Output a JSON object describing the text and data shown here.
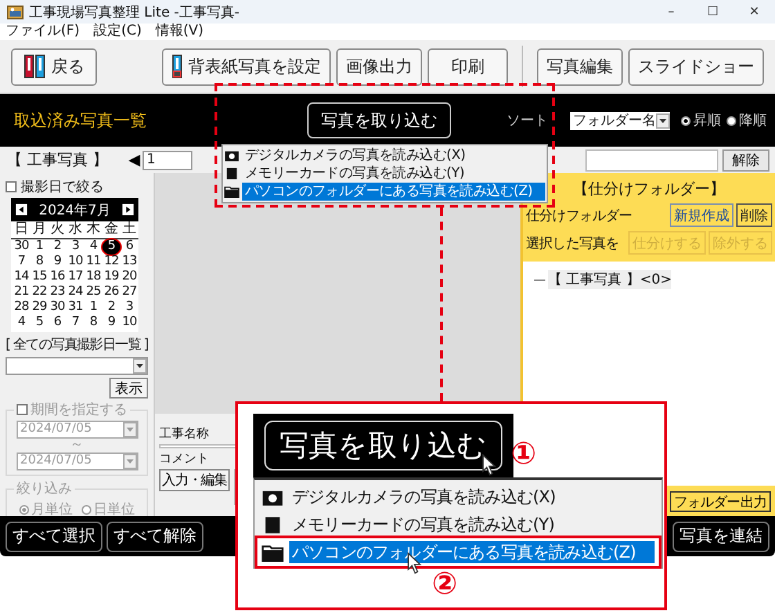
{
  "window": {
    "title": "工事現場写真整理 Lite -工事写真-",
    "controls": [
      "–",
      "☐",
      "✕"
    ]
  },
  "menu": [
    "ファイル(F)",
    "設定(C)",
    "情報(V)"
  ],
  "toolbar": {
    "back": "戻る",
    "spine": "背表紙写真を設定",
    "buttons": [
      "画像出力",
      "印刷"
    ],
    "right_buttons": [
      "写真編集",
      "スライドショー"
    ]
  },
  "header": {
    "title": "取込済み写真一覧",
    "import_button": "写真を取り込む",
    "sort_label": "ソート",
    "sort_value": "フォルダー名",
    "order": [
      {
        "label": "昇順",
        "selected": true
      },
      {
        "label": "降順",
        "selected": false
      }
    ]
  },
  "import_menu": [
    {
      "label": "デジタルカメラの写真を読み込む(X)",
      "kind": "camera",
      "selected": false
    },
    {
      "label": "メモリーカードの写真を読み込む(Y)",
      "kind": "card",
      "selected": false
    },
    {
      "label": "パソコンのフォルダーにある写真を読み込む(Z)",
      "kind": "folder",
      "selected": true
    }
  ],
  "album_row": {
    "title": "【 工事写真 】",
    "prev": "◀",
    "page": "1",
    "clear": "解除"
  },
  "left_panel": {
    "filter_by_date": {
      "label": "撮影日で絞る",
      "checked": false
    },
    "calendar": {
      "month": "2024年7月",
      "weekdays": [
        "日",
        "月",
        "火",
        "水",
        "木",
        "金",
        "土"
      ],
      "weeks": [
        [
          {
            "label": "30",
            "selected": false
          },
          {
            "label": "1",
            "selected": false
          },
          {
            "label": "2",
            "selected": false
          },
          {
            "label": "3",
            "selected": false
          },
          {
            "label": "4",
            "selected": false
          },
          {
            "label": "5",
            "selected": true
          },
          {
            "label": "6",
            "selected": false
          }
        ],
        [
          {
            "label": "7",
            "selected": false
          },
          {
            "label": "8",
            "selected": false
          },
          {
            "label": "9",
            "selected": false
          },
          {
            "label": "10",
            "selected": false
          },
          {
            "label": "11",
            "selected": false
          },
          {
            "label": "12",
            "selected": false
          },
          {
            "label": "13",
            "selected": false
          }
        ],
        [
          {
            "label": "14",
            "selected": false
          },
          {
            "label": "15",
            "selected": false
          },
          {
            "label": "16",
            "selected": false
          },
          {
            "label": "17",
            "selected": false
          },
          {
            "label": "18",
            "selected": false
          },
          {
            "label": "19",
            "selected": false
          },
          {
            "label": "20",
            "selected": false
          }
        ],
        [
          {
            "label": "21",
            "selected": false
          },
          {
            "label": "22",
            "selected": false
          },
          {
            "label": "23",
            "selected": false
          },
          {
            "label": "24",
            "selected": false
          },
          {
            "label": "25",
            "selected": false
          },
          {
            "label": "26",
            "selected": false
          },
          {
            "label": "27",
            "selected": false
          }
        ],
        [
          {
            "label": "28",
            "selected": false
          },
          {
            "label": "29",
            "selected": false
          },
          {
            "label": "30",
            "selected": false
          },
          {
            "label": "31",
            "selected": false
          },
          {
            "label": "1",
            "selected": false
          },
          {
            "label": "2",
            "selected": false
          },
          {
            "label": "3",
            "selected": false
          }
        ],
        [
          {
            "label": "4",
            "selected": false
          },
          {
            "label": "5",
            "selected": false
          },
          {
            "label": "6",
            "selected": false
          },
          {
            "label": "7",
            "selected": false
          },
          {
            "label": "8",
            "selected": false
          },
          {
            "label": "9",
            "selected": false
          },
          {
            "label": "10",
            "selected": false
          }
        ]
      ]
    },
    "all_dates_label": "[ 全ての写真撮影日一覧 ]",
    "show_button": "表示",
    "period": {
      "label": "期間を指定する",
      "checked": false,
      "disabled": true,
      "from": "2024/07/05",
      "tilde": "～",
      "to": "2024/07/05"
    },
    "refine": {
      "label": "絞り込み",
      "disabled": true,
      "options": [
        {
          "label": "月単位",
          "selected": true
        },
        {
          "label": "日単位",
          "selected": false
        }
      ]
    }
  },
  "details": {
    "name_label": "工事名称",
    "comment_label": "コメント",
    "edit_button": "入力・編集"
  },
  "sort_panel": {
    "title": "【仕分けフォルダー】",
    "folder_label": "仕分けフォルダー",
    "folder_buttons": [
      {
        "label": "新規作成",
        "disabled": false
      },
      {
        "label": "削除",
        "disabled": false
      }
    ],
    "selected_label": "選択した写真を",
    "photo_buttons": [
      {
        "label": "仕分けする",
        "disabled": true
      },
      {
        "label": "除外する",
        "disabled": true
      }
    ],
    "tree": [
      {
        "label": "【 工事写真 】<0>"
      }
    ],
    "export_button": "フォルダー出力"
  },
  "bottom_bar": {
    "buttons": [
      "すべて選択",
      "すべて解除"
    ],
    "right_button": "写真を連結"
  },
  "callout": {
    "button": "写真を取り込む",
    "step1": "①",
    "step2": "②",
    "menu": [
      {
        "label": "デジタルカメラの写真を読み込む(X)",
        "kind": "camera",
        "selected": false
      },
      {
        "label": "メモリーカードの写真を読み込む(Y)",
        "kind": "card",
        "selected": false
      },
      {
        "label": "パソコンのフォルダーにある写真を読み込む(Z)",
        "kind": "folder",
        "selected": true
      }
    ]
  }
}
